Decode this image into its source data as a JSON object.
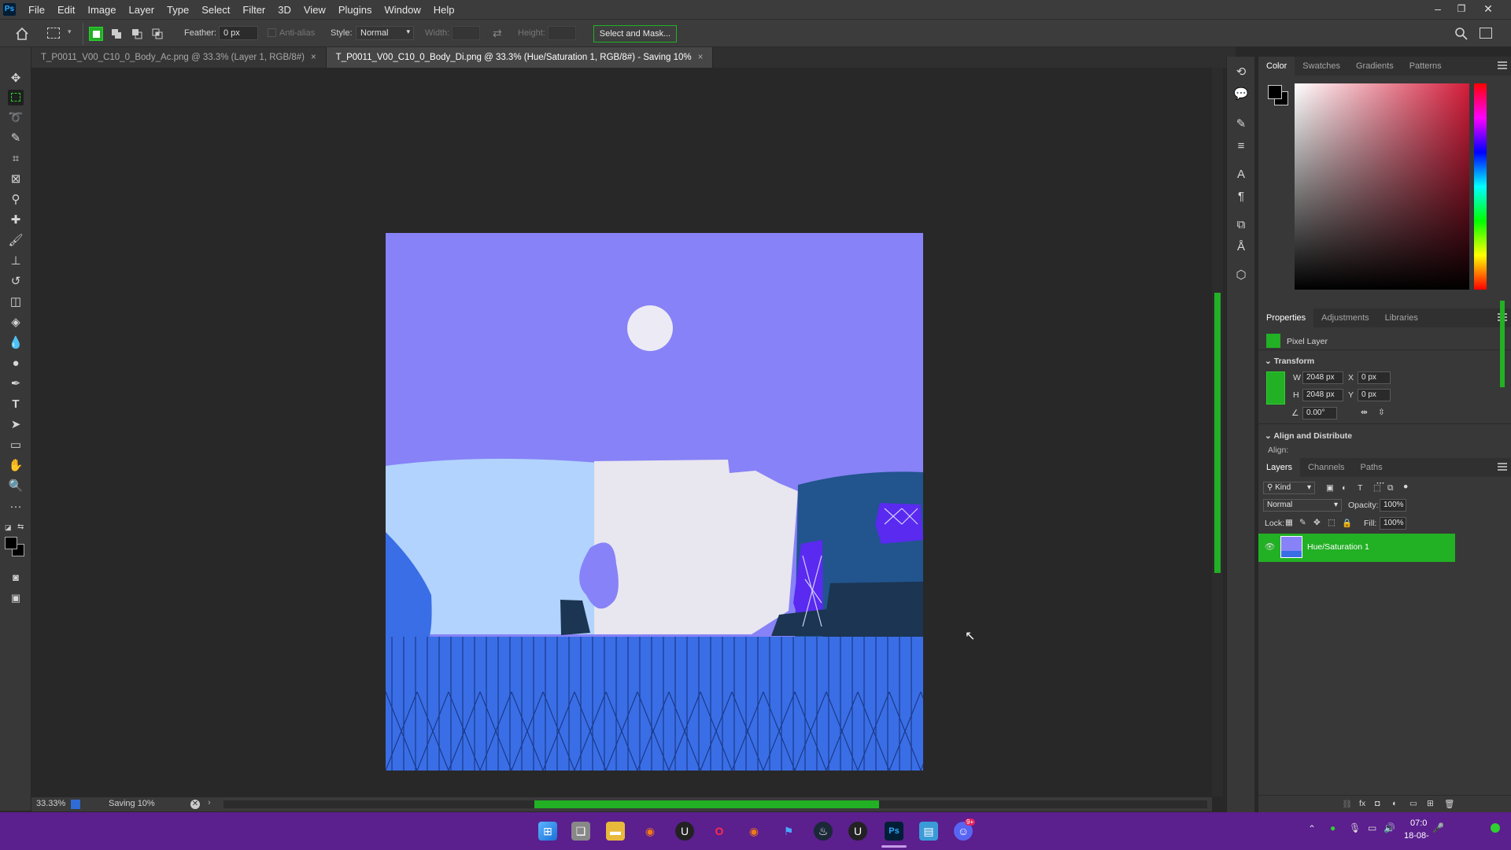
{
  "app": {
    "logo": "Ps",
    "title_icon": "photoshop-logo"
  },
  "menu": [
    "File",
    "Edit",
    "Image",
    "Layer",
    "Type",
    "Select",
    "Filter",
    "3D",
    "View",
    "Plugins",
    "Window",
    "Help"
  ],
  "window_controls": {
    "minimize": "–",
    "restore": "❐",
    "close": "✕"
  },
  "options": {
    "feather_label": "Feather:",
    "feather_value": "0 px",
    "anti_alias": "Anti-alias",
    "style_label": "Style:",
    "style_value": "Normal",
    "width_label": "Width:",
    "height_label": "Height:",
    "select_mask": "Select and Mask..."
  },
  "tabs": [
    {
      "label": "T_P0011_V00_C10_0_Body_Ac.png @ 33.3% (Layer 1, RGB/8#)",
      "close": "×"
    },
    {
      "label": "T_P0011_V00_C10_0_Body_Di.png @ 33.3% (Hue/Saturation 1, RGB/8#) - Saving 10%",
      "close": "×"
    }
  ],
  "status": {
    "zoom": "33.33%",
    "message": "Saving 10%",
    "progress": 0.47
  },
  "color_panel": {
    "tabs": [
      "Color",
      "Swatches",
      "Gradients",
      "Patterns"
    ],
    "hue_accent": "#d41c3a"
  },
  "properties": {
    "tabs": [
      "Properties",
      "Adjustments",
      "Libraries"
    ],
    "type_label": "Pixel Layer",
    "transform_label": "Transform",
    "w_label": "W",
    "w_value": "2048 px",
    "h_label": "H",
    "h_value": "2048 px",
    "x_label": "X",
    "x_value": "0 px",
    "y_label": "Y",
    "y_value": "0 px",
    "angle_value": "0.00°",
    "align_section": "Align and Distribute",
    "align_label": "Align:",
    "more": "···"
  },
  "layers": {
    "tabs": [
      "Layers",
      "Channels",
      "Paths"
    ],
    "filter_kind": "Kind",
    "blend_mode": "Normal",
    "opacity_label": "Opacity:",
    "opacity_value": "100%",
    "lock_label": "Lock:",
    "fill_label": "Fill:",
    "fill_value": "100%",
    "items": [
      {
        "name": "Hue/Saturation 1",
        "selected": true
      }
    ],
    "footer_icons": [
      "link-icon",
      "fx-icon",
      "mask-icon",
      "adjustment-icon",
      "folder-icon",
      "new-layer-icon",
      "trash-icon"
    ]
  },
  "taskbar": {
    "time": "07:0",
    "date": "18-08-",
    "badge": "9+"
  },
  "colors": {
    "accent_green": "#22b024",
    "taskbar_purple": "#5b1f8e",
    "sky": "#8782f7",
    "ground_blue": "#3a6ee6"
  }
}
